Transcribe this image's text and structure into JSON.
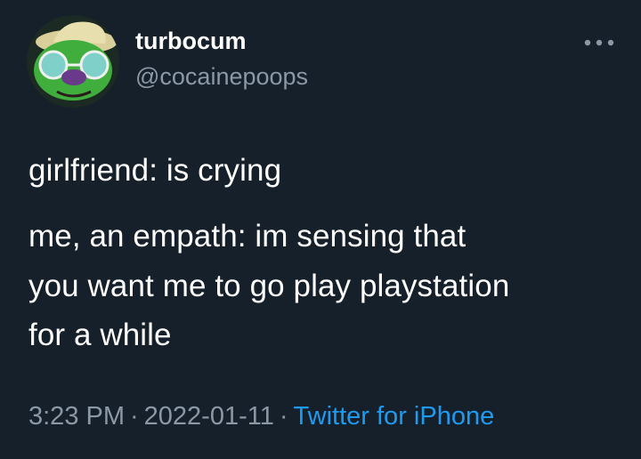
{
  "user": {
    "display_name": "turbocum",
    "handle": "@cocainepoops"
  },
  "tweet": {
    "lines": [
      "girlfriend: is crying",
      "me, an empath: im sensing that",
      "you want me to go play playstation",
      "for a while"
    ]
  },
  "meta": {
    "time": "3:23 PM",
    "separator": "·",
    "date": "2022-01-11",
    "source": "Twitter for iPhone"
  },
  "icons": {
    "avatar": "avatar",
    "more": "more-icon"
  },
  "colors": {
    "background": "#15202b",
    "text": "#ffffff",
    "secondary": "#8b98a5",
    "link": "#1d9bf0"
  }
}
